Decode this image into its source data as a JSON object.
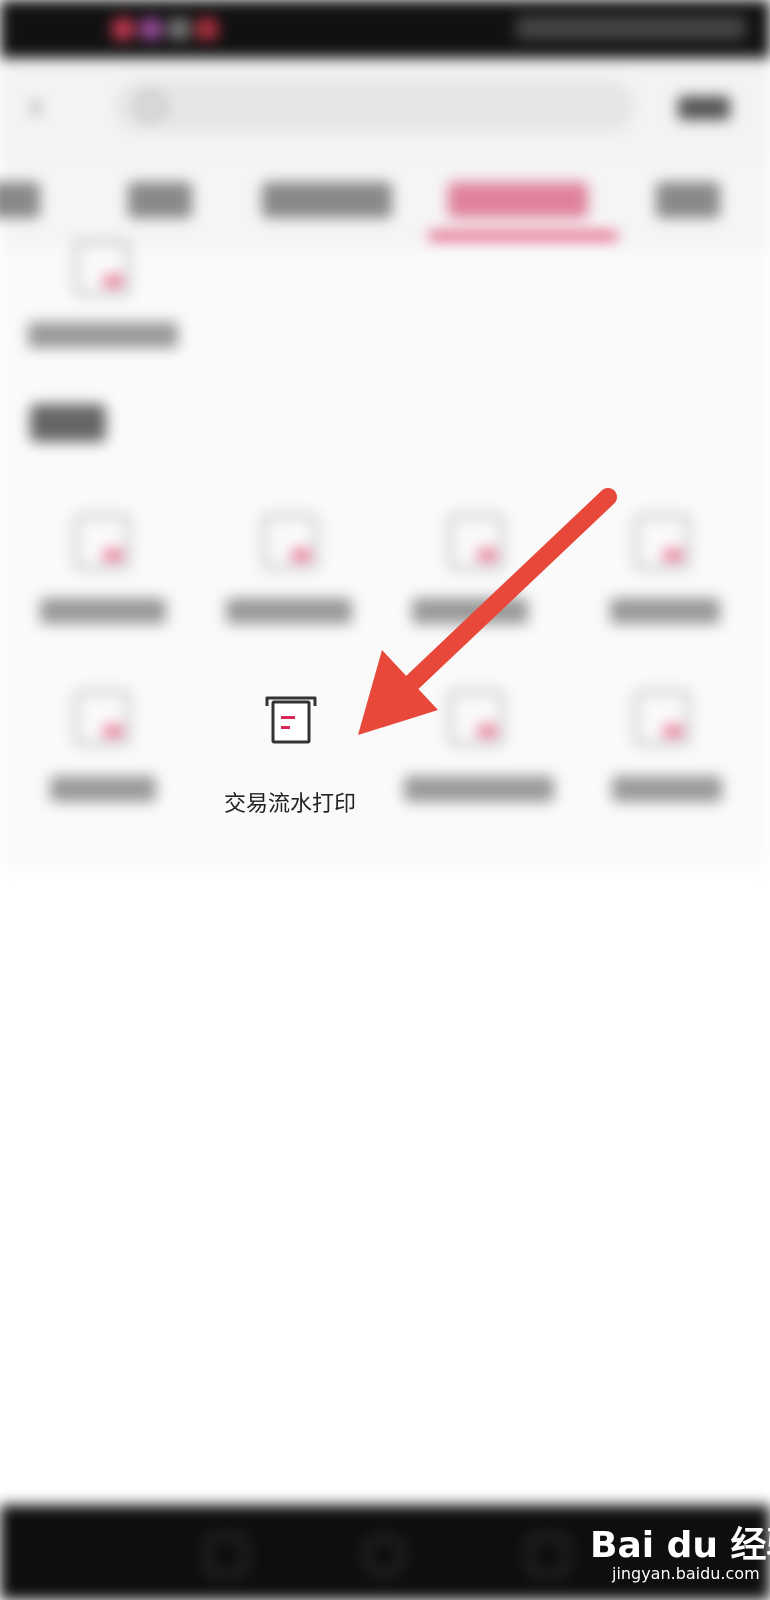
{
  "app": {
    "focused_item": {
      "label": "交易流水打印",
      "icon": "receipt-printer-icon"
    },
    "accent_color": "#d7285a",
    "arrow_color": "#e8483a"
  },
  "watermark": {
    "brand": "Bai du 经验",
    "site": "jingyan.baidu.com"
  }
}
